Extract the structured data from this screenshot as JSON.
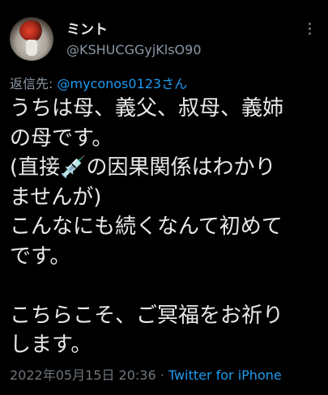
{
  "tweet": {
    "display_name": "ミント",
    "handle": "@KSHUCGGyjKlsO90",
    "reply_prefix": "返信先: ",
    "reply_to": "@myconos0123さん",
    "text_line1": "うちは母、義父、叔母、義姉",
    "text_line2": "の母です。",
    "text_line3_a": "(直接",
    "syringe_emoji": "💉",
    "text_line3_b": "の因果関係はわかり",
    "text_line4": "ませんが)",
    "text_line5": "こんなにも続くなんて初めて",
    "text_line6": "です。",
    "text_line7": "",
    "text_line8": "こちらこそ、ご冥福をお祈り",
    "text_line9": "します。",
    "timestamp": "2022年05月15日 20:36",
    "separator": " · ",
    "source": "Twitter for iPhone"
  },
  "icons": {
    "avatar": "profile-avatar-flowers",
    "more": "more-vertical-icon"
  },
  "colors": {
    "background": "#000000",
    "text": "#e7e9ea",
    "secondary": "#8b98a5",
    "link": "#1d9bf0"
  }
}
